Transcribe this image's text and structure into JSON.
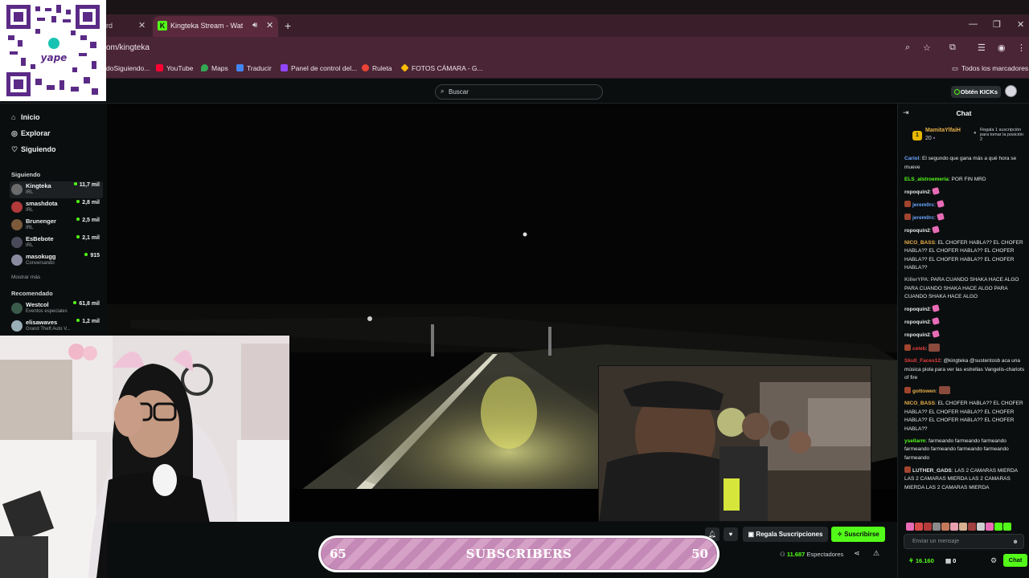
{
  "browser": {
    "inactive_tab": "rd",
    "active_tab_title": "Kingteka Stream - Watch Li",
    "active_tab_favicon": "K",
    "url": "om/kingteka",
    "bookmarks": [
      {
        "label": "doSiguiendo...",
        "icon": "none",
        "color": "#4a2535"
      },
      {
        "label": "YouTube",
        "icon": "youtube-icon",
        "color": "#ff0033"
      },
      {
        "label": "Maps",
        "icon": "maps-icon",
        "color": "#34a853"
      },
      {
        "label": "Traducir",
        "icon": "translate-icon",
        "color": "#4285f4"
      },
      {
        "label": "Panel de control del...",
        "icon": "twitch-icon",
        "color": "#9146ff"
      },
      {
        "label": "Ruleta",
        "icon": "google-icon",
        "color": "#ea4335"
      },
      {
        "label": "FOTOS CÁMARA - G...",
        "icon": "drive-icon",
        "color": "#fbbc04"
      }
    ],
    "all_bookmarks": "Todos los marcadores"
  },
  "qr_overlay": {
    "brand": "yape"
  },
  "top": {
    "search_placeholder": "Buscar",
    "kicks_button": "Obtén KICKs"
  },
  "sidebar": {
    "nav": [
      {
        "label": "Inicio",
        "icon": "home-icon"
      },
      {
        "label": "Explorar",
        "icon": "compass-icon"
      },
      {
        "label": "Siguiendo",
        "icon": "heart-icon"
      }
    ],
    "following_title": "Siguiendo",
    "following": [
      {
        "name": "Kingteka",
        "category": "IRL",
        "viewers": "11,7 mil",
        "color": "#6b6b6b"
      },
      {
        "name": "smashdota",
        "category": "IRL",
        "viewers": "2,8 mil",
        "color": "#b33a3a"
      },
      {
        "name": "Brunenger",
        "category": "IRL",
        "viewers": "2,5 mil",
        "color": "#7a5a3a"
      },
      {
        "name": "EsBebote",
        "category": "IRL",
        "viewers": "2,1 mil",
        "color": "#4a4a5a"
      },
      {
        "name": "masokugg",
        "category": "Conversando",
        "viewers": "915",
        "color": "#8a8aa0"
      }
    ],
    "show_more": "Mostrar más",
    "recommended_title": "Recomendado",
    "recommended": [
      {
        "name": "Westcol",
        "category": "Eventos especiales",
        "viewers": "61,8 mil",
        "color": "#3a5a4a"
      },
      {
        "name": "elisawaves",
        "category": "Grand Theft Auto V...",
        "viewers": "1,2 mil",
        "color": "#9ab0b8"
      }
    ]
  },
  "player": {
    "gift_subs": "Regala Suscripciones",
    "subscribe": "Suscribirse",
    "viewers_count": "11.687",
    "viewers_label": "Espectadores"
  },
  "sub_goal": {
    "current": "65",
    "label": "SUBSCRIBERS",
    "target": "50"
  },
  "chat": {
    "title": "Chat",
    "pinned": {
      "user": "MamitaYlfaiH",
      "count": "20",
      "rank": "1",
      "text": "Regala 1 suscripción para tomar la posición 2"
    },
    "messages": [
      {
        "user": "Cariol",
        "color": "#6aa6ff",
        "text": "El segundo que gana más a qué hora se mueve",
        "badge": false,
        "hearts": 0
      },
      {
        "user": "ELS_alstroemeria",
        "color": "#53fc18",
        "text": "POR FIN MRD",
        "badge": false,
        "hearts": 0
      },
      {
        "user": "ropoquin2",
        "color": "#e8e8e8",
        "text": "",
        "badge": false,
        "hearts": 1
      },
      {
        "user": "jerem0rc",
        "color": "#6aa6ff",
        "text": "",
        "badge": true,
        "hearts": 1
      },
      {
        "user": "jerem0rc",
        "color": "#6aa6ff",
        "text": "",
        "badge": true,
        "hearts": 1
      },
      {
        "user": "ropoquin2",
        "color": "#e8e8e8",
        "text": "",
        "badge": false,
        "hearts": 1
      },
      {
        "user": "NICO_BASS",
        "color": "#e8b04a",
        "text": "EL CHOFER HABLA?? EL CHOFER HABLA?? EL CHOFER HABLA?? EL CHOFER HABLA?? EL CHOFER HABLA?? EL CHOFER HABLA??",
        "badge": false,
        "hearts": 0
      },
      {
        "user": "KillerYPA",
        "color": "#9aa0a4",
        "text": "PARA CUANDO SHAKA HACE ALGO PARA CUANDO SHAKA HACE ALGO PARA CUANDO SHAKA HACE ALGO",
        "badge": false,
        "hearts": 0
      },
      {
        "user": "ropoquin2",
        "color": "#e8e8e8",
        "text": "",
        "badge": false,
        "hearts": 1
      },
      {
        "user": "ropoquin2",
        "color": "#e8e8e8",
        "text": "",
        "badge": false,
        "hearts": 1
      },
      {
        "user": "ropoquin2",
        "color": "#e8e8e8",
        "text": "",
        "badge": false,
        "hearts": 1
      },
      {
        "user": "celeb",
        "color": "#e83e3e",
        "text": "",
        "badge": true,
        "hearts": 0,
        "emote": true
      },
      {
        "user": "Skull_Faces12",
        "color": "#e83e3e",
        "text": "@kingteka @sustentosb aca una música piola para ver las estrellas Vangelis-chariots of fire",
        "badge": false,
        "hearts": 0
      },
      {
        "user": "gottowen",
        "color": "#e8b04a",
        "text": "",
        "badge": true,
        "hearts": 0,
        "emote": true
      },
      {
        "user": "NICO_BASS",
        "color": "#e8b04a",
        "text": "EL CHOFER HABLA?? EL CHOFER HABLA?? EL CHOFER HABLA?? EL CHOFER HABLA?? EL CHOFER HABLA?? EL CHOFER HABLA??",
        "badge": false,
        "hearts": 0
      },
      {
        "user": "ysellarm",
        "color": "#53fc18",
        "text": "farmeando farmeando farmeando farmeando farmeando farmeando farmeando farmeando",
        "badge": false,
        "hearts": 0
      },
      {
        "user": "LUTHER_GADS",
        "color": "#e8e8e8",
        "text": "LAS 2 CAMARAS MIERDA LAS 2 CAMARAS MIERDA LAS 2 CAMARAS MIERDA LAS 2 CAMARAS MIERDA",
        "badge": true,
        "hearts": 0
      }
    ],
    "input_placeholder": "Enviar un mensaje",
    "points": "16.160",
    "kicks": "0",
    "send": "Chat"
  }
}
